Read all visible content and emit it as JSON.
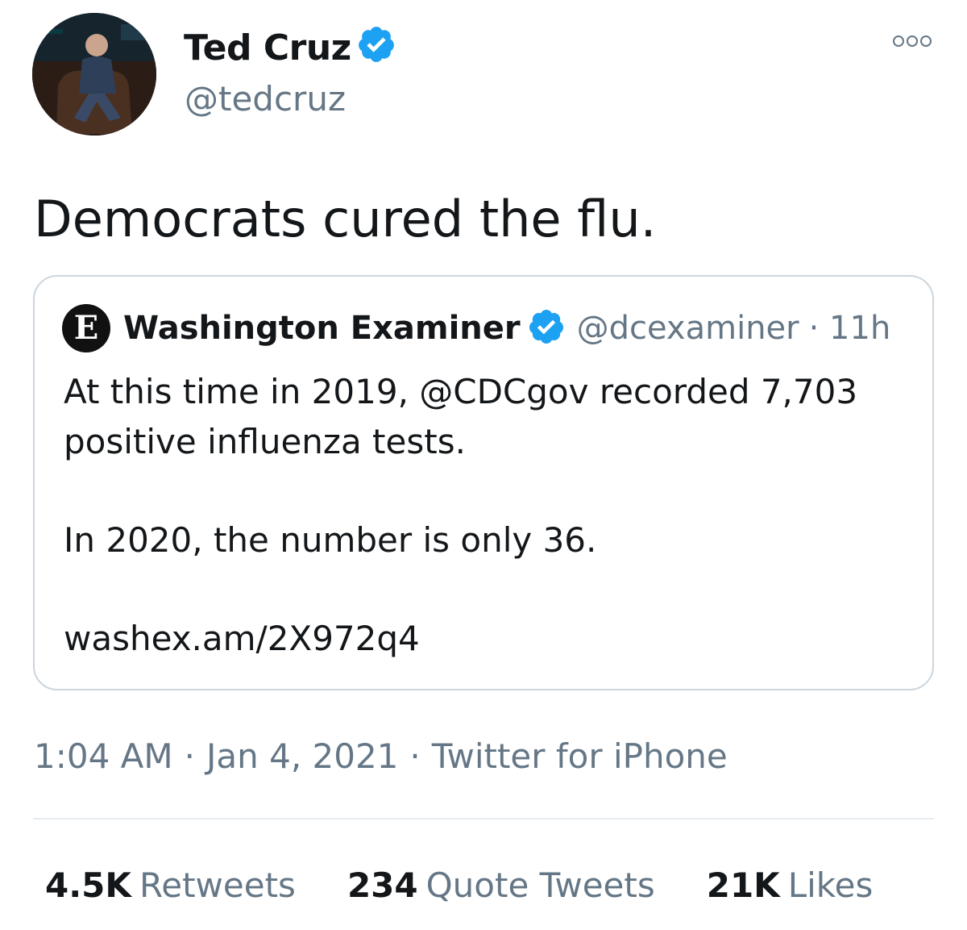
{
  "tweet": {
    "author": {
      "name": "Ted Cruz",
      "handle": "@tedcruz",
      "verified": true
    },
    "text": "Democrats cured the flu.",
    "quoted": {
      "logo_letter": "E",
      "name": "Washington Examiner",
      "handle": "@dcexaminer",
      "time": "· 11h",
      "lines": [
        "At this time in 2019, @CDCgov recorded 7,703",
        "positive influenza tests.",
        "In 2020, the number is only 36.",
        "washex.am/2X972q4"
      ]
    },
    "meta": {
      "time": "1:04 AM",
      "date": "Jan 4, 2021",
      "source": "Twitter for iPhone",
      "separator": "·"
    },
    "stats": {
      "retweets_count": "4.5K",
      "retweets_label": "Retweets",
      "quotes_count": "234",
      "quotes_label": "Quote Tweets",
      "likes_count": "21K",
      "likes_label": "Likes"
    }
  },
  "colors": {
    "verified_blue": "#1da1f2",
    "secondary_text": "#657786",
    "border": "#ccd6dd"
  },
  "icons": {
    "verified": "verified-badge-icon",
    "more": "more-options-icon"
  }
}
